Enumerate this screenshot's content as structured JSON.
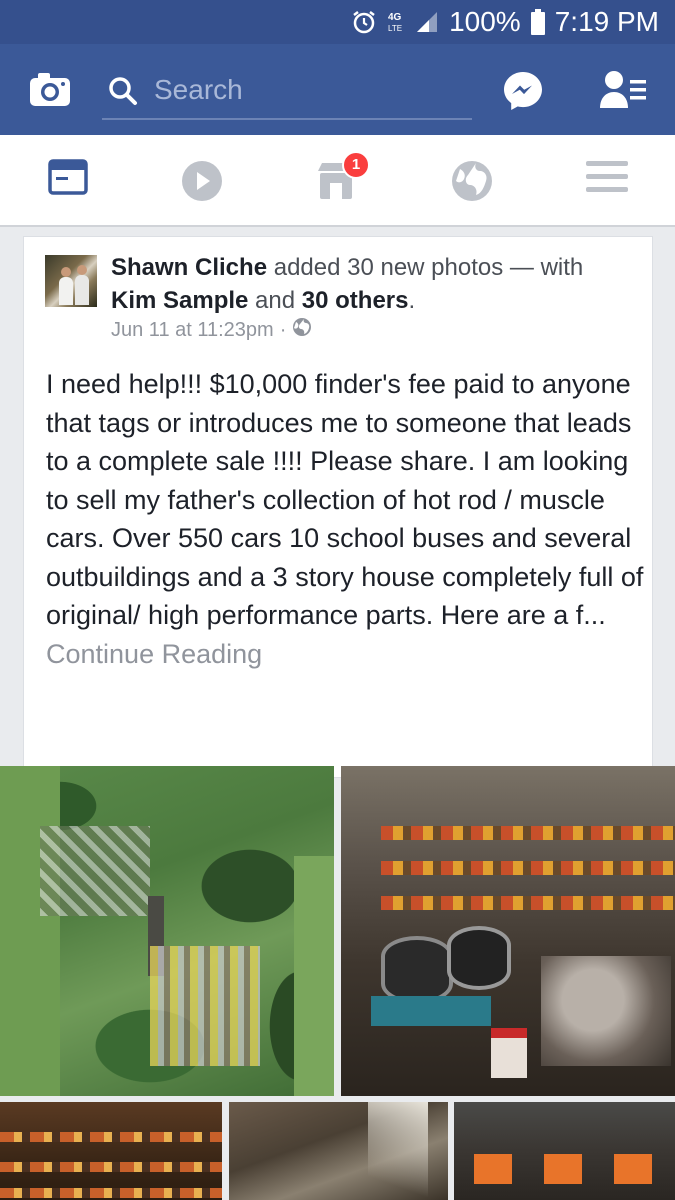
{
  "status_bar": {
    "battery": "100%",
    "time": "7:19 PM",
    "network": "4G LTE"
  },
  "header": {
    "search_placeholder": "Search"
  },
  "nav": {
    "tabs": [
      "news-feed",
      "videos",
      "marketplace",
      "notifications",
      "menu"
    ],
    "marketplace_badge": "1"
  },
  "post": {
    "author": "Shawn Cliche",
    "action": " added 30 new photos — with ",
    "tagged": "Kim Sample",
    "and": " and ",
    "others": "30 others",
    "period": ".",
    "timestamp": "Jun 11 at 11:23pm",
    "separator": "·",
    "audience_icon": "globe-icon",
    "text": "I need help!!! $10,000 finder's fee paid to anyone that tags or introduces me  to someone that leads to a complete sale !!!! Please share. I am looking to sell my father's collection of hot rod / muscle cars. Over 550 cars 10 school buses and several outbuildings and a 3 story house completely full of original/ high performance parts. Here are a f... ",
    "continue_label": "Continue Reading"
  },
  "colors": {
    "brand": "#3b5998",
    "status_bar": "#35508d",
    "badge": "#fa3e3e",
    "active_tab": "#3b5998",
    "inactive_tab": "#bec2c9"
  }
}
